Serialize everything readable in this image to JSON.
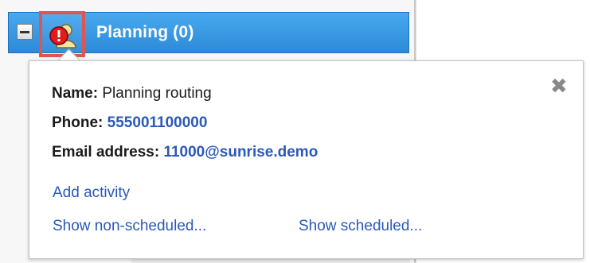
{
  "tree": {
    "row_label": "Planning (0)"
  },
  "tooltip": {
    "name_key": "Name:",
    "name_value": "Planning routing",
    "phone_key": "Phone:",
    "phone_value": "555001100000",
    "email_key": "Email address:",
    "email_value": "11000@sunrise.demo",
    "add_activity": "Add activity",
    "show_non_scheduled": "Show non-scheduled...",
    "show_scheduled": "Show scheduled...",
    "close_glyph": "✖"
  },
  "icons": {
    "collapse": "minus-icon",
    "group": "group-warning-icon",
    "close": "close-icon"
  },
  "colors": {
    "row_bg": "#2d8ad8",
    "highlight_frame": "#e0554f",
    "link": "#2a59b8"
  }
}
